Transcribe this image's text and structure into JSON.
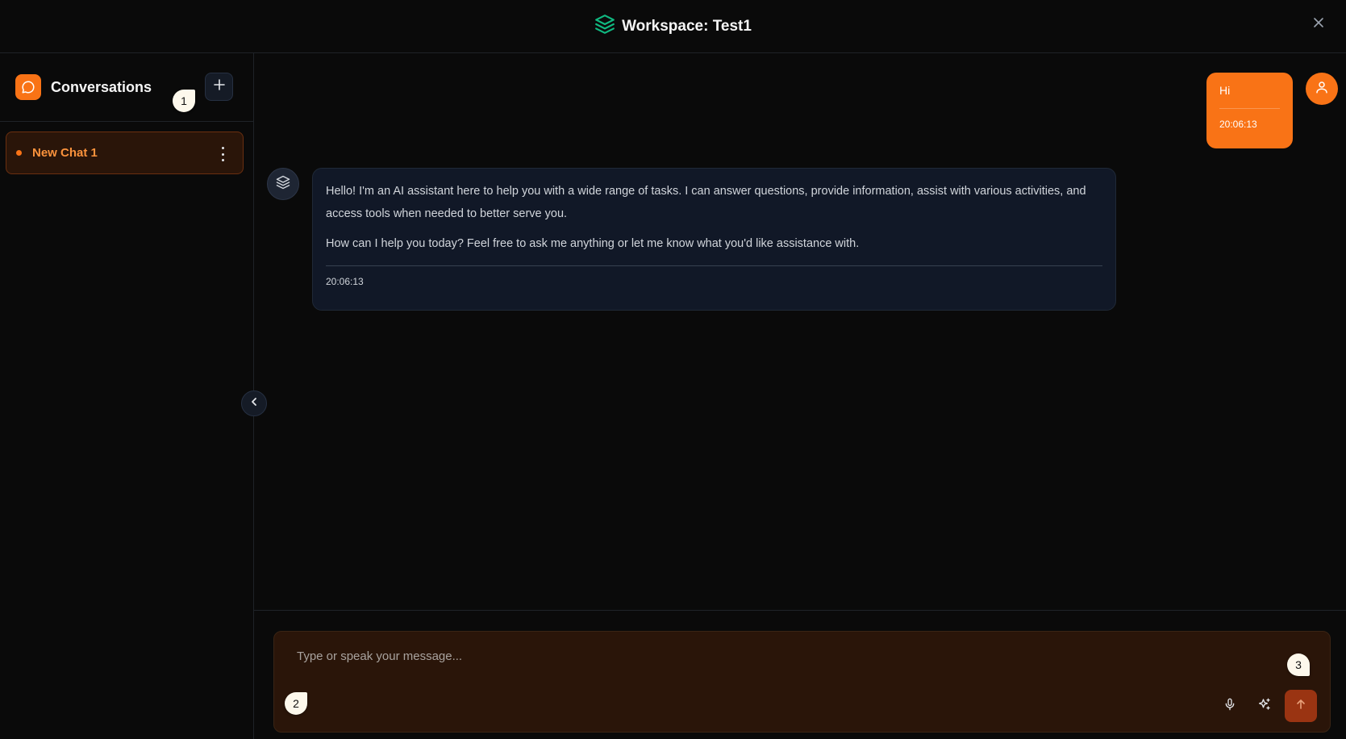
{
  "header": {
    "title": "Workspace: Test1",
    "logo_icon": "layers-icon",
    "close_icon": "close-icon",
    "accent": "#10b981"
  },
  "sidebar": {
    "title": "Conversations",
    "icon": "chat-bubble-icon",
    "new_button_icon": "plus-icon",
    "chats": [
      {
        "label": "New Chat 1",
        "active": true
      }
    ]
  },
  "messages": [
    {
      "role": "user",
      "text": "Hi",
      "time": "20:06:13"
    },
    {
      "role": "assistant",
      "paragraphs": [
        "Hello! I'm an AI assistant here to help you with a wide range of tasks. I can answer questions, provide information, assist with various activities, and access tools when needed to better serve you.",
        "How can I help you today? Feel free to ask me anything or let me know what you'd like assistance with."
      ],
      "time": "20:06:13"
    }
  ],
  "composer": {
    "placeholder": "Type or speak your message...",
    "value": ""
  },
  "markers": [
    "1",
    "2",
    "3"
  ],
  "colors": {
    "accent": "#f97316",
    "background": "#0a0a0a",
    "assistant_bubble": "#111827",
    "composer": "#2a1509",
    "send_button": "#9a3412"
  }
}
